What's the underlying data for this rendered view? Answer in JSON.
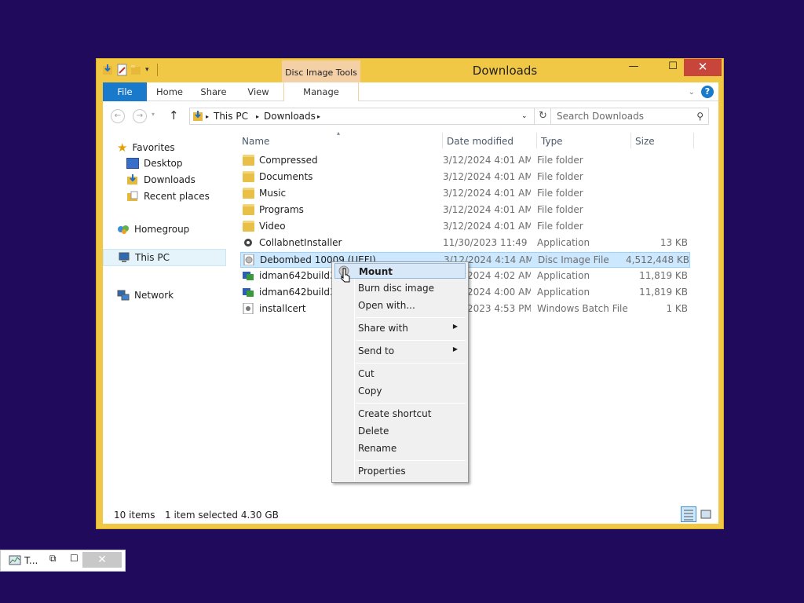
{
  "window": {
    "title": "Downloads",
    "contextual_tab_group": "Disc Image Tools",
    "controls": {
      "minimize": "—",
      "maximize": "☐",
      "close": "✕"
    }
  },
  "ribbon": {
    "tabs": [
      "File",
      "Home",
      "Share",
      "View",
      "Manage"
    ],
    "help": "?"
  },
  "address": {
    "crumbs": [
      "This PC",
      "Downloads"
    ],
    "search_placeholder": "Search Downloads"
  },
  "nav": {
    "favorites": "Favorites",
    "favorites_items": [
      "Desktop",
      "Downloads",
      "Recent places"
    ],
    "homegroup": "Homegroup",
    "this_pc": "This PC",
    "network": "Network"
  },
  "columns": {
    "name": "Name",
    "date": "Date modified",
    "type": "Type",
    "size": "Size"
  },
  "files": [
    {
      "name": "Compressed",
      "date": "3/12/2024 4:01 AM",
      "type": "File folder",
      "size": "",
      "icon": "folder-icon"
    },
    {
      "name": "Documents",
      "date": "3/12/2024 4:01 AM",
      "type": "File folder",
      "size": "",
      "icon": "folder-icon"
    },
    {
      "name": "Music",
      "date": "3/12/2024 4:01 AM",
      "type": "File folder",
      "size": "",
      "icon": "folder-icon"
    },
    {
      "name": "Programs",
      "date": "3/12/2024 4:01 AM",
      "type": "File folder",
      "size": "",
      "icon": "folder-icon"
    },
    {
      "name": "Video",
      "date": "3/12/2024 4:01 AM",
      "type": "File folder",
      "size": "",
      "icon": "folder-icon"
    },
    {
      "name": "CollabnetInstaller",
      "date": "11/30/2023 11:49 ...",
      "type": "Application",
      "size": "13 KB",
      "icon": "app-gear-icon"
    },
    {
      "name": "Debombed 10009 (UEFI)",
      "date": "3/12/2024 4:14 AM",
      "type": "Disc Image File",
      "size": "4,512,448 KB",
      "icon": "disc-image-icon"
    },
    {
      "name": "idman642build3 (",
      "date": "3/12/2024 4:02 AM",
      "type": "Application",
      "size": "11,819 KB",
      "icon": "installer-icon"
    },
    {
      "name": "idman642build3",
      "date": "3/12/2024 4:00 AM",
      "type": "Application",
      "size": "11,819 KB",
      "icon": "installer-icon"
    },
    {
      "name": "installcert",
      "date": "3/12/2023 4:53 PM",
      "type": "Windows Batch File",
      "size": "1 KB",
      "icon": "batch-file-icon"
    }
  ],
  "status": {
    "count": "10 items",
    "selection": "1 item selected  4.30 GB"
  },
  "context_menu": {
    "mount": "Mount",
    "burn": "Burn disc image",
    "open_with": "Open with...",
    "share_with": "Share with",
    "send_to": "Send to",
    "cut": "Cut",
    "copy": "Copy",
    "create_shortcut": "Create shortcut",
    "delete": "Delete",
    "rename": "Rename",
    "properties": "Properties"
  },
  "mini_window": {
    "label": "T..."
  }
}
